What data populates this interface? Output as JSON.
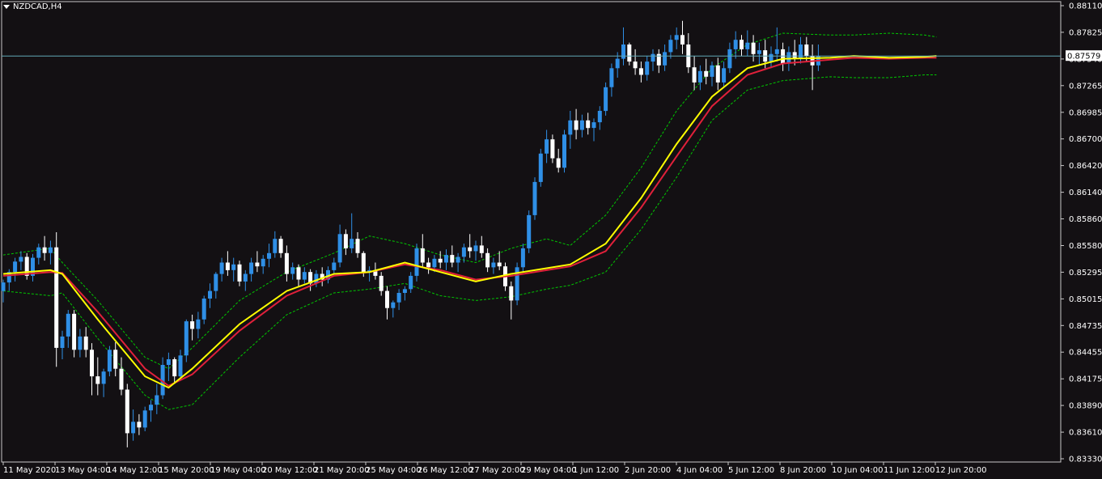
{
  "window": {
    "symbol_title": "NZDCAD,H4",
    "menu_icon": "triangle-down-icon"
  },
  "colors": {
    "background": "#131013",
    "frame": "#c8c8c8",
    "text": "#ffffff",
    "bull_candle": "#2f8fe6",
    "bear_candle": "#ffffff",
    "ma_fast": "#ffff00",
    "ma_slow": "#e0203a",
    "envelope": "#00c800",
    "bid_line": "#5fa7b4",
    "price_label_bg": "#ffffff",
    "price_label_text": "#000000"
  },
  "price_axis": {
    "ticks": [
      "0.88110",
      "0.87825",
      "0.87540",
      "0.87265",
      "0.86985",
      "0.86700",
      "0.86420",
      "0.86140",
      "0.85860",
      "0.85580",
      "0.85295",
      "0.85015",
      "0.84735",
      "0.84455",
      "0.84175",
      "0.83890",
      "0.83610",
      "0.83330"
    ],
    "current_price": "0.87579"
  },
  "time_axis": {
    "labels": [
      "11 May 2020",
      "13 May 04:00",
      "14 May 12:00",
      "15 May 20:00",
      "19 May 04:00",
      "20 May 12:00",
      "21 May 20:00",
      "25 May 04:00",
      "26 May 12:00",
      "27 May 20:00",
      "29 May 04:00",
      "1 Jun 12:00",
      "2 Jun 20:00",
      "4 Jun 04:00",
      "5 Jun 12:00",
      "8 Jun 20:00",
      "10 Jun 04:00",
      "11 Jun 12:00",
      "12 Jun 20:00"
    ]
  },
  "chart_data": {
    "type": "candlestick",
    "symbol": "NZDCAD",
    "timeframe": "H4",
    "ylim": [
      0.8333,
      0.8811
    ],
    "grid": false,
    "current_price": 0.87579,
    "indicators": [
      "moving average (fast, yellow)",
      "moving average (slow, red)",
      "envelopes (green dashed)"
    ],
    "candles": [
      [
        0.851,
        0.8522,
        0.8498,
        0.8519
      ],
      [
        0.8519,
        0.8533,
        0.851,
        0.853
      ],
      [
        0.853,
        0.8545,
        0.852,
        0.8541
      ],
      [
        0.8541,
        0.8552,
        0.8532,
        0.8546
      ],
      [
        0.8546,
        0.855,
        0.8522,
        0.8526
      ],
      [
        0.8526,
        0.8549,
        0.852,
        0.8545
      ],
      [
        0.8545,
        0.856,
        0.8538,
        0.8556
      ],
      [
        0.8556,
        0.8568,
        0.8542,
        0.855
      ],
      [
        0.855,
        0.8563,
        0.8538,
        0.8556
      ],
      [
        0.8556,
        0.8572,
        0.843,
        0.845
      ],
      [
        0.845,
        0.8468,
        0.8438,
        0.8462
      ],
      [
        0.8462,
        0.849,
        0.845,
        0.8486
      ],
      [
        0.8486,
        0.849,
        0.844,
        0.8448
      ],
      [
        0.8448,
        0.847,
        0.844,
        0.8462
      ],
      [
        0.8462,
        0.8472,
        0.844,
        0.8448
      ],
      [
        0.8448,
        0.8455,
        0.84,
        0.842
      ],
      [
        0.842,
        0.844,
        0.84,
        0.8412
      ],
      [
        0.8412,
        0.8428,
        0.8398,
        0.8425
      ],
      [
        0.8425,
        0.8452,
        0.842,
        0.8448
      ],
      [
        0.8448,
        0.8456,
        0.842,
        0.8428
      ],
      [
        0.8428,
        0.844,
        0.84,
        0.8406
      ],
      [
        0.8406,
        0.8412,
        0.8345,
        0.836
      ],
      [
        0.836,
        0.8385,
        0.8352,
        0.8372
      ],
      [
        0.8372,
        0.838,
        0.8358,
        0.8366
      ],
      [
        0.8366,
        0.8388,
        0.8362,
        0.8384
      ],
      [
        0.8384,
        0.8395,
        0.8372,
        0.839
      ],
      [
        0.839,
        0.8412,
        0.838,
        0.84
      ],
      [
        0.84,
        0.844,
        0.8396,
        0.8432
      ],
      [
        0.8432,
        0.8445,
        0.8415,
        0.8438
      ],
      [
        0.8438,
        0.844,
        0.8412,
        0.842
      ],
      [
        0.842,
        0.8448,
        0.8415,
        0.8442
      ],
      [
        0.8442,
        0.848,
        0.8435,
        0.8478
      ],
      [
        0.8478,
        0.8485,
        0.8458,
        0.847
      ],
      [
        0.847,
        0.8488,
        0.846,
        0.848
      ],
      [
        0.848,
        0.8505,
        0.8475,
        0.8502
      ],
      [
        0.8502,
        0.8518,
        0.8492,
        0.851
      ],
      [
        0.851,
        0.853,
        0.8502,
        0.8528
      ],
      [
        0.8528,
        0.8545,
        0.852,
        0.854
      ],
      [
        0.854,
        0.8552,
        0.8526,
        0.8532
      ],
      [
        0.8532,
        0.8545,
        0.852,
        0.8538
      ],
      [
        0.8538,
        0.8542,
        0.8515,
        0.852
      ],
      [
        0.852,
        0.8532,
        0.851,
        0.8528
      ],
      [
        0.8528,
        0.8545,
        0.852,
        0.854
      ],
      [
        0.854,
        0.8552,
        0.853,
        0.8536
      ],
      [
        0.8536,
        0.8548,
        0.8528,
        0.8544
      ],
      [
        0.8544,
        0.856,
        0.8535,
        0.855
      ],
      [
        0.855,
        0.8573,
        0.8545,
        0.8565
      ],
      [
        0.8565,
        0.8568,
        0.8545,
        0.855
      ],
      [
        0.855,
        0.8558,
        0.852,
        0.8528
      ],
      [
        0.8528,
        0.854,
        0.8522,
        0.8535
      ],
      [
        0.8535,
        0.8538,
        0.8515,
        0.8522
      ],
      [
        0.8522,
        0.8535,
        0.8518,
        0.853
      ],
      [
        0.853,
        0.8533,
        0.851,
        0.8518
      ],
      [
        0.8518,
        0.8532,
        0.8514,
        0.8528
      ],
      [
        0.8528,
        0.8535,
        0.8515,
        0.8522
      ],
      [
        0.8522,
        0.8536,
        0.8518,
        0.8532
      ],
      [
        0.8532,
        0.8545,
        0.8528,
        0.854
      ],
      [
        0.854,
        0.858,
        0.8535,
        0.857
      ],
      [
        0.857,
        0.8575,
        0.8548,
        0.8555
      ],
      [
        0.8555,
        0.8592,
        0.855,
        0.8565
      ],
      [
        0.8565,
        0.8572,
        0.8545,
        0.855
      ],
      [
        0.855,
        0.8552,
        0.8525,
        0.853
      ],
      [
        0.853,
        0.8536,
        0.852,
        0.8532
      ],
      [
        0.8532,
        0.854,
        0.8522,
        0.8526
      ],
      [
        0.8526,
        0.853,
        0.8505,
        0.851
      ],
      [
        0.851,
        0.8515,
        0.848,
        0.8492
      ],
      [
        0.8492,
        0.85,
        0.8482,
        0.8498
      ],
      [
        0.8498,
        0.8512,
        0.849,
        0.8508
      ],
      [
        0.8508,
        0.8515,
        0.85,
        0.8512
      ],
      [
        0.8512,
        0.853,
        0.8508,
        0.8526
      ],
      [
        0.8526,
        0.856,
        0.852,
        0.8555
      ],
      [
        0.8555,
        0.857,
        0.8535,
        0.854
      ],
      [
        0.854,
        0.8545,
        0.8528,
        0.8535
      ],
      [
        0.8535,
        0.8548,
        0.853,
        0.8544
      ],
      [
        0.8544,
        0.8552,
        0.8534,
        0.854
      ],
      [
        0.854,
        0.8554,
        0.8532,
        0.8548
      ],
      [
        0.8548,
        0.8558,
        0.8535,
        0.854
      ],
      [
        0.854,
        0.855,
        0.853,
        0.8546
      ],
      [
        0.8546,
        0.856,
        0.854,
        0.8556
      ],
      [
        0.8556,
        0.857,
        0.8545,
        0.8552
      ],
      [
        0.8552,
        0.8563,
        0.8542,
        0.8558
      ],
      [
        0.8558,
        0.8568,
        0.8545,
        0.855
      ],
      [
        0.855,
        0.8555,
        0.853,
        0.8535
      ],
      [
        0.8535,
        0.8545,
        0.8528,
        0.854
      ],
      [
        0.854,
        0.8552,
        0.8532,
        0.8536
      ],
      [
        0.8536,
        0.854,
        0.851,
        0.8515
      ],
      [
        0.8515,
        0.852,
        0.848,
        0.85
      ],
      [
        0.85,
        0.854,
        0.8495,
        0.8535
      ],
      [
        0.8535,
        0.856,
        0.853,
        0.8555
      ],
      [
        0.8555,
        0.8595,
        0.855,
        0.859
      ],
      [
        0.859,
        0.863,
        0.8585,
        0.8625
      ],
      [
        0.8625,
        0.866,
        0.862,
        0.8655
      ],
      [
        0.8655,
        0.868,
        0.8645,
        0.867
      ],
      [
        0.867,
        0.8675,
        0.8645,
        0.865
      ],
      [
        0.865,
        0.866,
        0.8635,
        0.864
      ],
      [
        0.864,
        0.868,
        0.8635,
        0.8675
      ],
      [
        0.8675,
        0.87,
        0.866,
        0.869
      ],
      [
        0.869,
        0.8702,
        0.867,
        0.868
      ],
      [
        0.868,
        0.8696,
        0.8672,
        0.869
      ],
      [
        0.869,
        0.8698,
        0.8675,
        0.8682
      ],
      [
        0.8682,
        0.8692,
        0.8668,
        0.8688
      ],
      [
        0.8688,
        0.8705,
        0.868,
        0.87
      ],
      [
        0.87,
        0.873,
        0.8695,
        0.8725
      ],
      [
        0.8725,
        0.875,
        0.8715,
        0.8745
      ],
      [
        0.8745,
        0.8762,
        0.8735,
        0.8755
      ],
      [
        0.8755,
        0.8788,
        0.8748,
        0.877
      ],
      [
        0.877,
        0.8772,
        0.8748,
        0.8752
      ],
      [
        0.8752,
        0.8765,
        0.8738,
        0.8745
      ],
      [
        0.8745,
        0.8752,
        0.873,
        0.8738
      ],
      [
        0.8738,
        0.8758,
        0.8732,
        0.8752
      ],
      [
        0.8752,
        0.8765,
        0.8742,
        0.876
      ],
      [
        0.876,
        0.8765,
        0.874,
        0.8748
      ],
      [
        0.8748,
        0.877,
        0.8742,
        0.8762
      ],
      [
        0.8762,
        0.878,
        0.8755,
        0.8775
      ],
      [
        0.8775,
        0.8788,
        0.8765,
        0.878
      ],
      [
        0.878,
        0.8795,
        0.876,
        0.877
      ],
      [
        0.877,
        0.8782,
        0.874,
        0.8746
      ],
      [
        0.8746,
        0.8758,
        0.8722,
        0.873
      ],
      [
        0.873,
        0.8748,
        0.8722,
        0.8742
      ],
      [
        0.8742,
        0.8755,
        0.8728,
        0.8736
      ],
      [
        0.8736,
        0.8752,
        0.8726,
        0.8748
      ],
      [
        0.8748,
        0.8756,
        0.8722,
        0.873
      ],
      [
        0.873,
        0.8752,
        0.8725,
        0.8745
      ],
      [
        0.8745,
        0.8772,
        0.874,
        0.8765
      ],
      [
        0.8765,
        0.8784,
        0.8755,
        0.8775
      ],
      [
        0.8775,
        0.878,
        0.8758,
        0.8765
      ],
      [
        0.8765,
        0.8785,
        0.8758,
        0.8772
      ],
      [
        0.8772,
        0.878,
        0.8752,
        0.876
      ],
      [
        0.876,
        0.8772,
        0.8748,
        0.8764
      ],
      [
        0.8764,
        0.8775,
        0.8745,
        0.8752
      ],
      [
        0.8752,
        0.8768,
        0.8745,
        0.876
      ],
      [
        0.876,
        0.8788,
        0.8752,
        0.8765
      ],
      [
        0.8765,
        0.8772,
        0.8742,
        0.875
      ],
      [
        0.875,
        0.8768,
        0.8742,
        0.8762
      ],
      [
        0.8762,
        0.8775,
        0.8748,
        0.8756
      ],
      [
        0.8756,
        0.8778,
        0.875,
        0.877
      ],
      [
        0.877,
        0.8778,
        0.8752,
        0.8758
      ],
      [
        0.8758,
        0.877,
        0.8722,
        0.8748
      ],
      [
        0.8748,
        0.877,
        0.8742,
        0.8758
      ]
    ],
    "ma_fast": [
      [
        0,
        0.8528
      ],
      [
        8,
        0.8532
      ],
      [
        10,
        0.8528
      ],
      [
        16,
        0.848
      ],
      [
        24,
        0.842
      ],
      [
        28,
        0.8408
      ],
      [
        32,
        0.8428
      ],
      [
        40,
        0.8475
      ],
      [
        48,
        0.851
      ],
      [
        56,
        0.8528
      ],
      [
        62,
        0.853
      ],
      [
        68,
        0.854
      ],
      [
        74,
        0.853
      ],
      [
        80,
        0.852
      ],
      [
        86,
        0.8528
      ],
      [
        92,
        0.8534
      ],
      [
        96,
        0.8538
      ],
      [
        102,
        0.856
      ],
      [
        108,
        0.8608
      ],
      [
        114,
        0.8665
      ],
      [
        120,
        0.8715
      ],
      [
        126,
        0.8745
      ],
      [
        132,
        0.8755
      ],
      [
        140,
        0.8756
      ],
      [
        144,
        0.8758
      ],
      [
        150,
        0.8756
      ],
      [
        156,
        0.8757
      ],
      [
        158,
        0.8758
      ]
    ],
    "ma_slow": [
      [
        0,
        0.8526
      ],
      [
        8,
        0.853
      ],
      [
        10,
        0.8529
      ],
      [
        16,
        0.8488
      ],
      [
        24,
        0.8428
      ],
      [
        28,
        0.841
      ],
      [
        32,
        0.8422
      ],
      [
        40,
        0.8468
      ],
      [
        48,
        0.8505
      ],
      [
        56,
        0.8526
      ],
      [
        62,
        0.853
      ],
      [
        68,
        0.8538
      ],
      [
        74,
        0.8532
      ],
      [
        80,
        0.8522
      ],
      [
        86,
        0.8526
      ],
      [
        92,
        0.8532
      ],
      [
        96,
        0.8536
      ],
      [
        102,
        0.8552
      ],
      [
        108,
        0.8598
      ],
      [
        114,
        0.8652
      ],
      [
        120,
        0.8705
      ],
      [
        126,
        0.8738
      ],
      [
        132,
        0.875
      ],
      [
        140,
        0.8754
      ],
      [
        144,
        0.8756
      ],
      [
        150,
        0.8755
      ],
      [
        156,
        0.8756
      ],
      [
        158,
        0.8756
      ]
    ],
    "envelope_upper": [
      [
        0,
        0.8548
      ],
      [
        8,
        0.8555
      ],
      [
        10,
        0.854
      ],
      [
        16,
        0.85
      ],
      [
        24,
        0.844
      ],
      [
        28,
        0.8428
      ],
      [
        32,
        0.845
      ],
      [
        40,
        0.85
      ],
      [
        48,
        0.853
      ],
      [
        56,
        0.855
      ],
      [
        62,
        0.8568
      ],
      [
        68,
        0.856
      ],
      [
        74,
        0.8548
      ],
      [
        80,
        0.854
      ],
      [
        86,
        0.8555
      ],
      [
        92,
        0.8565
      ],
      [
        96,
        0.8558
      ],
      [
        102,
        0.859
      ],
      [
        108,
        0.864
      ],
      [
        114,
        0.87
      ],
      [
        120,
        0.8745
      ],
      [
        126,
        0.877
      ],
      [
        132,
        0.8782
      ],
      [
        140,
        0.878
      ],
      [
        144,
        0.878
      ],
      [
        150,
        0.8782
      ],
      [
        156,
        0.878
      ],
      [
        158,
        0.8778
      ]
    ],
    "envelope_lower": [
      [
        0,
        0.851
      ],
      [
        8,
        0.8505
      ],
      [
        10,
        0.8508
      ],
      [
        16,
        0.846
      ],
      [
        24,
        0.84
      ],
      [
        28,
        0.8385
      ],
      [
        32,
        0.839
      ],
      [
        40,
        0.844
      ],
      [
        48,
        0.8485
      ],
      [
        56,
        0.8508
      ],
      [
        62,
        0.8512
      ],
      [
        68,
        0.8518
      ],
      [
        74,
        0.8505
      ],
      [
        80,
        0.85
      ],
      [
        86,
        0.8504
      ],
      [
        92,
        0.8512
      ],
      [
        96,
        0.8516
      ],
      [
        102,
        0.853
      ],
      [
        108,
        0.8575
      ],
      [
        114,
        0.863
      ],
      [
        120,
        0.869
      ],
      [
        126,
        0.8722
      ],
      [
        132,
        0.8732
      ],
      [
        140,
        0.8736
      ],
      [
        144,
        0.8735
      ],
      [
        150,
        0.8735
      ],
      [
        156,
        0.8738
      ],
      [
        158,
        0.8738
      ]
    ]
  }
}
